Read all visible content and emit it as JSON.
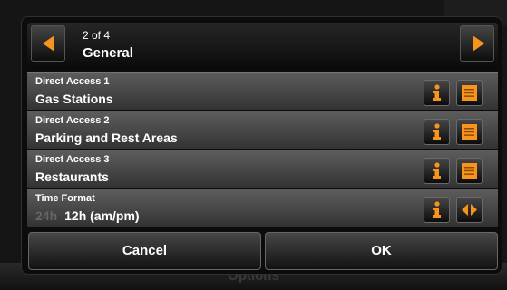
{
  "background": {
    "bottom_label": "Options"
  },
  "header": {
    "page_indicator": "2 of 4",
    "title": "General",
    "prev_icon": "arrow-left-icon",
    "next_icon": "arrow-right-icon"
  },
  "rows": [
    {
      "label": "Direct Access 1",
      "value": "Gas Stations",
      "info_icon": "info-icon",
      "action_icon": "list-icon"
    },
    {
      "label": "Direct Access 2",
      "value": "Parking and Rest Areas",
      "info_icon": "info-icon",
      "action_icon": "list-icon"
    },
    {
      "label": "Direct Access 3",
      "value": "Restaurants",
      "info_icon": "info-icon",
      "action_icon": "list-icon"
    },
    {
      "label": "Time Format",
      "inactive_option": "24h",
      "value": "12h (am/pm)",
      "info_icon": "info-icon",
      "action_icon": "toggle-arrows-icon"
    }
  ],
  "footer": {
    "cancel_label": "Cancel",
    "ok_label": "OK"
  },
  "colors": {
    "accent": "#F7941D",
    "row_bg": "#4A4A4A",
    "dialog_bg": "#0C0C0C"
  }
}
